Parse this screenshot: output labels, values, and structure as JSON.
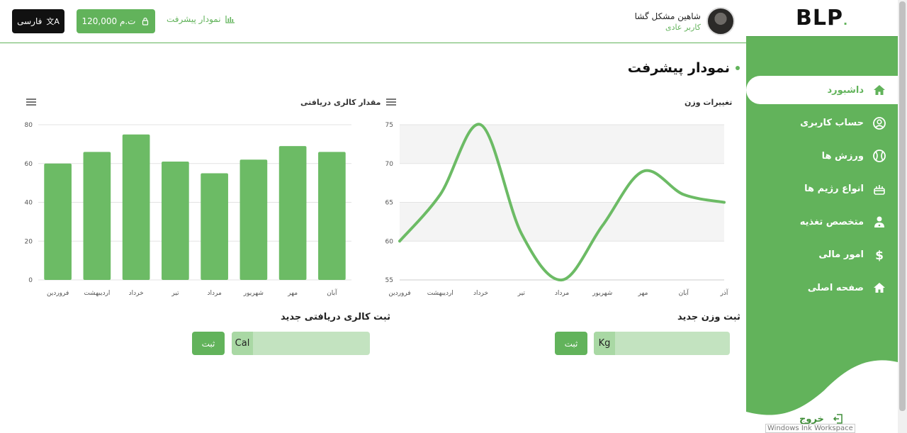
{
  "header": {
    "language_label": "فارسی",
    "balance_label": "120,000 ت.م",
    "progress_link": "نمودار پیشرفت",
    "user_name": "شاهین مشکل گشا",
    "user_role": "کاربر عادی"
  },
  "sidebar": {
    "logo": "BLP",
    "items": [
      {
        "label": "داشبورد",
        "icon": "home-icon"
      },
      {
        "label": "حساب کاربری",
        "icon": "user-circle-icon"
      },
      {
        "label": "ورزش ها",
        "icon": "ball-icon"
      },
      {
        "label": "انواع رژیم ها",
        "icon": "food-icon"
      },
      {
        "label": "متخصص تغذیه",
        "icon": "doctor-icon"
      },
      {
        "label": "امور مالی",
        "icon": "dollar-icon"
      },
      {
        "label": "صفحه اصلی",
        "icon": "home-icon"
      }
    ],
    "logout_label": "خروج"
  },
  "page": {
    "title": "نمودار پیشرفت"
  },
  "weight_card": {
    "title": "تغییرات وزن",
    "form_title": "ثبت وزن جدید",
    "unit": "Kg",
    "submit": "ثبت"
  },
  "calorie_card": {
    "title": "مقدار کالری دریافتی",
    "form_title": "ثبت کالری دریافتی جدید",
    "unit": "Cal",
    "submit": "ثبت"
  },
  "overlay": {
    "windows_ink": "Windows Ink Workspace"
  },
  "colors": {
    "accent": "#62b35b",
    "accent_light": "#c3e3c0",
    "dark_button": "#111111"
  },
  "chart_data": [
    {
      "type": "line",
      "title": "تغییرات وزن",
      "categories": [
        "فروردین",
        "اردیبهشت",
        "خرداد",
        "تیر",
        "مرداد",
        "شهریور",
        "مهر",
        "آبان",
        "آذر"
      ],
      "values": [
        60,
        66,
        75,
        61,
        55,
        62,
        69,
        66,
        65
      ],
      "ylim": [
        55,
        75
      ],
      "yticks": [
        55,
        60,
        65,
        70,
        75
      ],
      "grid": true
    },
    {
      "type": "bar",
      "title": "مقدار کالری دریافتی",
      "categories": [
        "فروردین",
        "اردیبهشت",
        "خرداد",
        "تیر",
        "مرداد",
        "شهریور",
        "مهر",
        "آبان"
      ],
      "values": [
        60,
        66,
        75,
        61,
        55,
        62,
        69,
        66
      ],
      "ylim": [
        0,
        80
      ],
      "yticks": [
        0,
        20,
        40,
        60,
        80
      ],
      "grid": true
    }
  ]
}
